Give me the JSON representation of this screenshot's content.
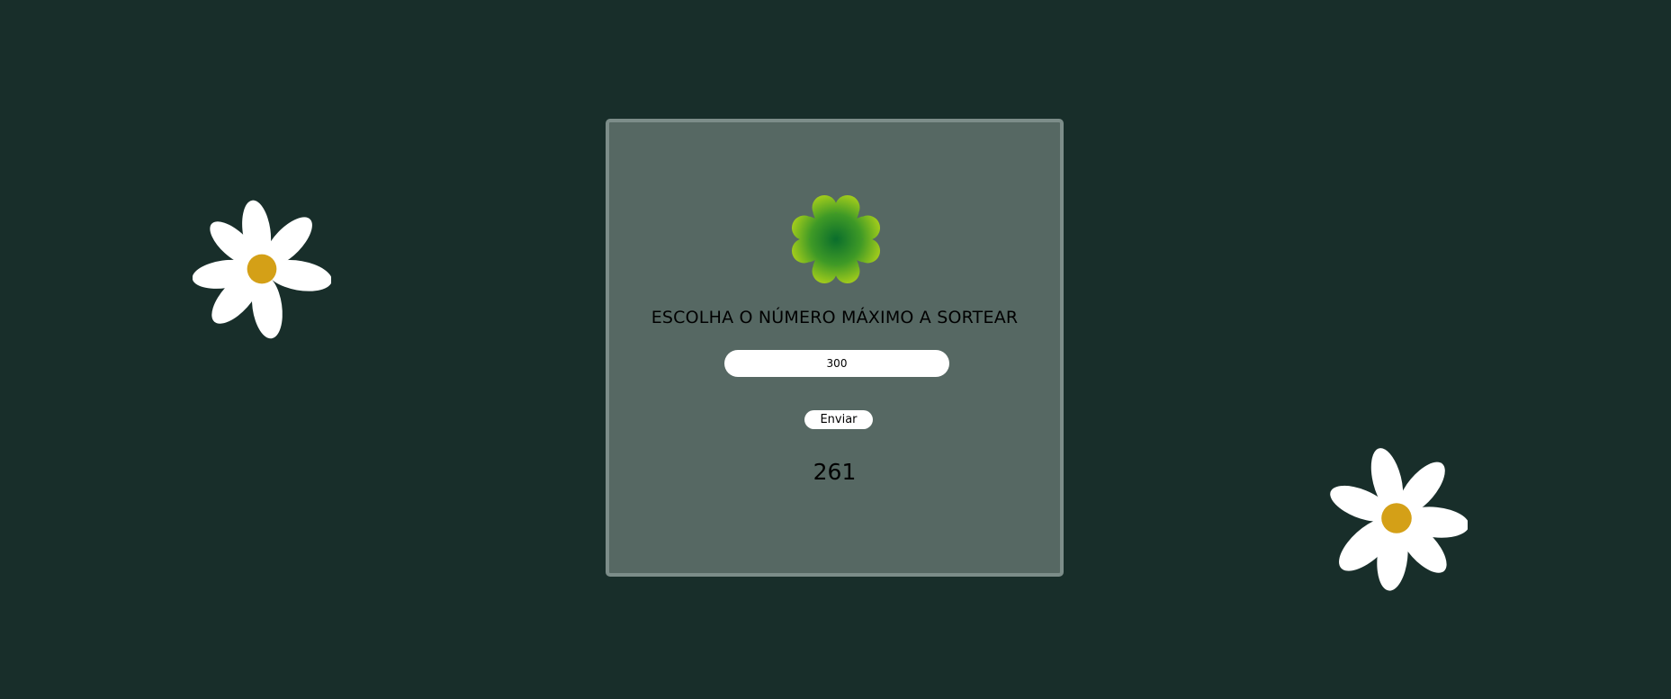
{
  "form": {
    "title": "ESCOLHA O NÚMERO MÁXIMO A SORTEAR",
    "max_number_value": "300",
    "submit_label": "Enviar"
  },
  "result": {
    "drawn_number": "261"
  },
  "icons": {
    "logo": "four-leaf-clover-icon",
    "decoration": "daisy-flower-icon"
  },
  "colors": {
    "background": "#182e2a",
    "card": "#566863",
    "card_border": "#7c8d89",
    "clover_dark": "#0a6e2c",
    "clover_light": "#96c71e",
    "petal": "#ffffff",
    "flower_center": "#d4a017"
  }
}
